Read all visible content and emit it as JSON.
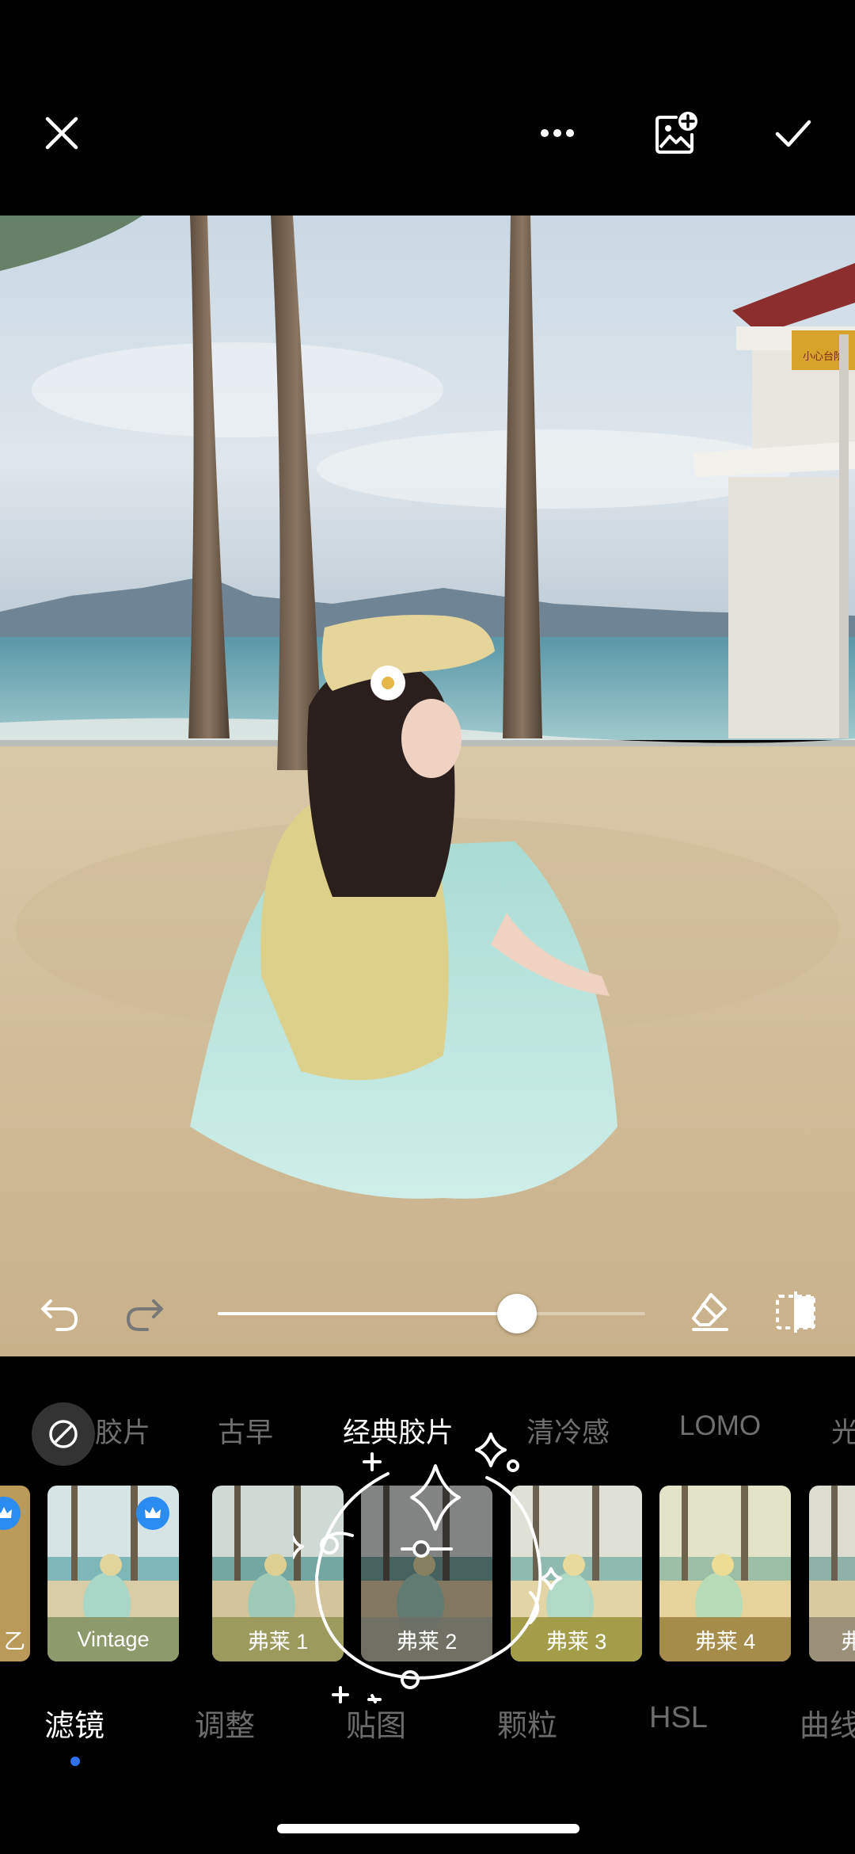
{
  "categories": [
    "胶片",
    "古早",
    "经典胶片",
    "清冷感",
    "LOMO",
    "光"
  ],
  "active_category": "经典胶片",
  "filters": [
    {
      "label": "乙",
      "premium": true
    },
    {
      "label": "Vintage",
      "premium": true
    },
    {
      "label": "弗莱 1",
      "premium": false
    },
    {
      "label": "弗莱 2",
      "premium": false,
      "selected": true
    },
    {
      "label": "弗莱 3",
      "premium": false
    },
    {
      "label": "弗莱 4",
      "premium": false
    },
    {
      "label": "弗",
      "premium": false
    }
  ],
  "tabs": [
    "滤镜",
    "调整",
    "贴图",
    "颗粒",
    "HSL",
    "曲线"
  ],
  "active_tab": "滤镜",
  "intensity_value": 0.7,
  "sign_text": "小心台阶",
  "icons": {
    "close": "close-icon",
    "more": "more-icon",
    "add_image": "add-image-icon",
    "confirm": "check-icon",
    "undo": "undo-icon",
    "redo": "redo-icon",
    "eraser": "eraser-icon",
    "compare": "compare-icon",
    "none": "no-filter-icon",
    "premium": "crown-icon"
  },
  "colors": {
    "accent": "#2f6ff0",
    "premium_badge": "#2a8cf0",
    "inactive_text": "#6f6f6f"
  }
}
